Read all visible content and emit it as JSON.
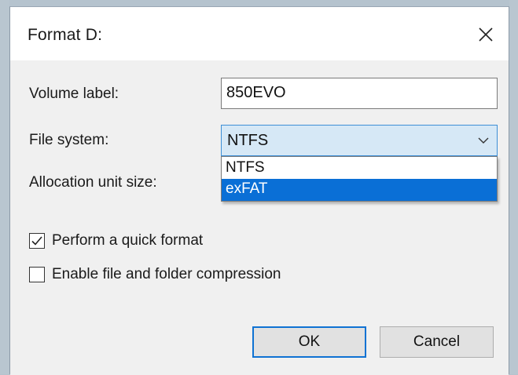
{
  "dialog": {
    "title": "Format D:",
    "close_icon": "close-icon"
  },
  "fields": {
    "volume_label_text": "Volume label:",
    "volume_label_value": "850EVO",
    "file_system_text": "File system:",
    "file_system_value": "NTFS",
    "allocation_unit_text": "Allocation unit size:"
  },
  "file_system_dropdown": {
    "options": [
      "NTFS",
      "exFAT"
    ],
    "highlighted": "exFAT",
    "highlight_color": "#0a6fd6"
  },
  "options": {
    "quick_format_label": "Perform a quick format",
    "quick_format_checked": true,
    "compression_label": "Enable file and folder compression",
    "compression_checked": false
  },
  "buttons": {
    "ok_label": "OK",
    "cancel_label": "Cancel"
  },
  "colors": {
    "focus_border": "#0f72d3",
    "combo_background": "#d6e8f6"
  }
}
